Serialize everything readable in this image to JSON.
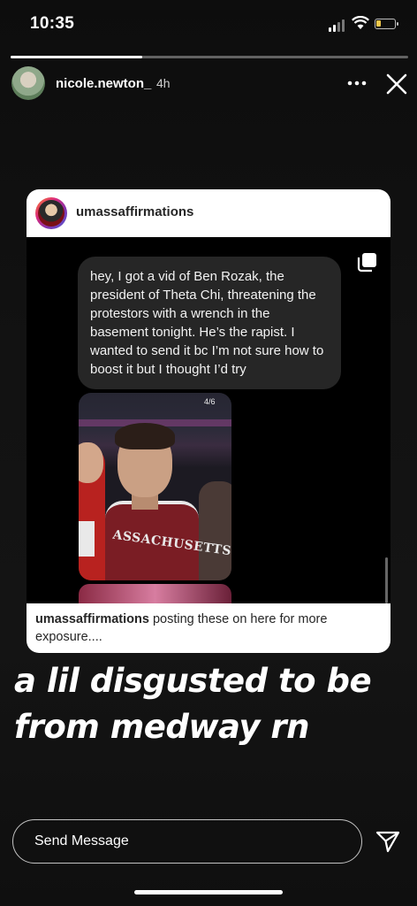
{
  "status_bar": {
    "time": "10:35",
    "battery_level": 0.25
  },
  "story": {
    "progress": 0.33,
    "username": "nicole.newton_",
    "posted_ago": "4h",
    "overlay_text_line1": "a lil disgusted to be",
    "overlay_text_line2": "from medway rn"
  },
  "shared_post": {
    "username": "umassaffirmations",
    "dm_message": "hey, I got a vid of Ben Rozak, the president of Theta Chi, threatening the protestors with a wrench in the basement tonight. He’s the rapist. I wanted to send it bc I’m not sure how to boost it but I thought I’d try",
    "photo_counter": "4/6",
    "jersey_text": "ASSACHUSETTS",
    "caption_user": "umassaffirmations",
    "caption_text": "posting these on here for more exposure...."
  },
  "reply": {
    "placeholder": "Send Message"
  },
  "icons": {
    "more": "more-horizontal-icon",
    "close": "close-icon",
    "send": "send-icon",
    "multi": "multiple-images-icon"
  }
}
